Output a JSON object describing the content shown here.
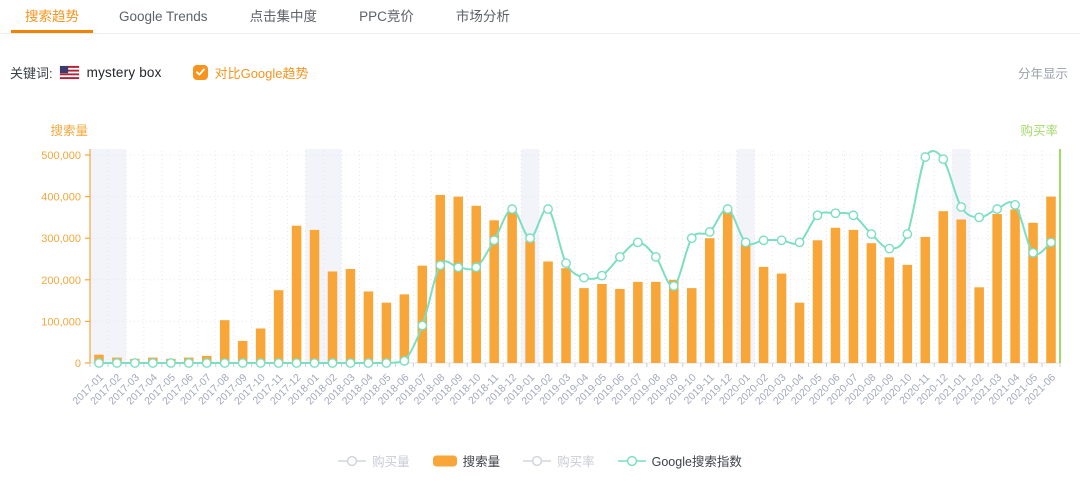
{
  "tabs": {
    "items": [
      {
        "label": "搜索趋势",
        "active": true
      },
      {
        "label": "Google Trends",
        "active": false
      },
      {
        "label": "点击集中度",
        "active": false
      },
      {
        "label": "PPC竞价",
        "active": false
      },
      {
        "label": "市场分析",
        "active": false
      }
    ]
  },
  "filter_bar": {
    "keyword_label": "关键词:",
    "flag_icon": "us-flag",
    "keyword_value": "mystery box",
    "compare_checkbox_checked": true,
    "compare_checkbox_label": "对比Google趋势",
    "year_display_label": "分年显示"
  },
  "colors": {
    "accent_orange": "#f7941e",
    "tab_underline": "#f08300",
    "bar_orange": "#f8a638",
    "axis_orange": "#f5a73b",
    "line_teal": "#7cdfc2",
    "right_axis_green": "#7fd134",
    "right_axis_label_green": "#a5d96a",
    "x_label_grey": "#a3a9bc",
    "band_fill": "#f2f4f9",
    "grid_grey": "#e6e8ef",
    "bottom_axis": "#dfe2e8",
    "legend_disabled": "#d2d5dc"
  },
  "chart_data": {
    "type": "bar",
    "combo": "bar+line",
    "left_axis_title": "搜索量",
    "right_axis_title": "购买率",
    "ylim": [
      0,
      500000
    ],
    "y_ticks": [
      "0",
      "100,000",
      "200,000",
      "300,000",
      "400,000",
      "500,000"
    ],
    "grid": "dotted",
    "legend_position": "bottom-center",
    "categories": [
      "2017-01",
      "2017-02",
      "2017-03",
      "2017-04",
      "2017-05",
      "2017-06",
      "2017-07",
      "2017-08",
      "2017-09",
      "2017-10",
      "2017-11",
      "2017-12",
      "2018-01",
      "2018-02",
      "2018-03",
      "2018-04",
      "2018-05",
      "2018-06",
      "2018-07",
      "2018-08",
      "2018-09",
      "2018-10",
      "2018-11",
      "2018-12",
      "2019-01",
      "2019-02",
      "2019-03",
      "2019-04",
      "2019-05",
      "2019-06",
      "2019-07",
      "2019-08",
      "2019-09",
      "2019-10",
      "2019-11",
      "2019-12",
      "2020-01",
      "2020-02",
      "2020-03",
      "2020-04",
      "2020-05",
      "2020-06",
      "2020-07",
      "2020-08",
      "2020-09",
      "2020-10",
      "2020-11",
      "2020-12",
      "2021-01",
      "2021-02",
      "2021-03",
      "2021-04",
      "2021-05",
      "2021-06"
    ],
    "series": [
      {
        "name": "搜索量",
        "type": "bar",
        "color": "#f8a638",
        "values": [
          20000,
          13000,
          10000,
          13000,
          10000,
          13000,
          17000,
          103000,
          53000,
          83000,
          175000,
          330000,
          320000,
          220000,
          226000,
          172000,
          145000,
          165000,
          234000,
          404000,
          400000,
          378000,
          343000,
          365000,
          293000,
          244000,
          228000,
          180000,
          190000,
          178000,
          195000,
          195000,
          200000,
          180000,
          300000,
          365000,
          286000,
          231000,
          215000,
          145000,
          295000,
          325000,
          320000,
          288000,
          254000,
          236000,
          303000,
          365000,
          345000,
          182000,
          358000,
          369000,
          337000,
          400000
        ]
      },
      {
        "name": "Google搜索指数",
        "type": "line",
        "color": "#7cdfc2",
        "scale_note": "index 0-100 mapped to full left-axis height",
        "values": [
          0,
          0,
          0,
          0,
          0,
          0,
          0,
          0,
          0,
          0,
          0,
          0,
          0,
          0,
          0,
          0,
          0,
          1,
          18,
          47,
          46,
          46,
          59,
          74,
          60,
          74,
          48,
          41,
          42,
          51,
          58,
          51,
          37,
          60,
          63,
          74,
          58,
          59,
          59,
          58,
          71,
          72,
          71,
          62,
          55,
          62,
          99,
          98,
          75,
          70,
          74,
          76,
          53,
          58
        ]
      }
    ],
    "highlight_bands": [
      {
        "month": "2017-01",
        "span": 2
      },
      {
        "month": "2018-01",
        "span": 2
      },
      {
        "month": "2019-01",
        "span": 1
      },
      {
        "month": "2020-01",
        "span": 1
      },
      {
        "month": "2021-01",
        "span": 1
      }
    ],
    "legend": [
      {
        "label": "购买量",
        "type": "line",
        "disabled": true
      },
      {
        "label": "搜索量",
        "type": "bar",
        "disabled": false
      },
      {
        "label": "购买率",
        "type": "line",
        "disabled": true
      },
      {
        "label": "Google搜索指数",
        "type": "line",
        "disabled": false
      }
    ]
  }
}
